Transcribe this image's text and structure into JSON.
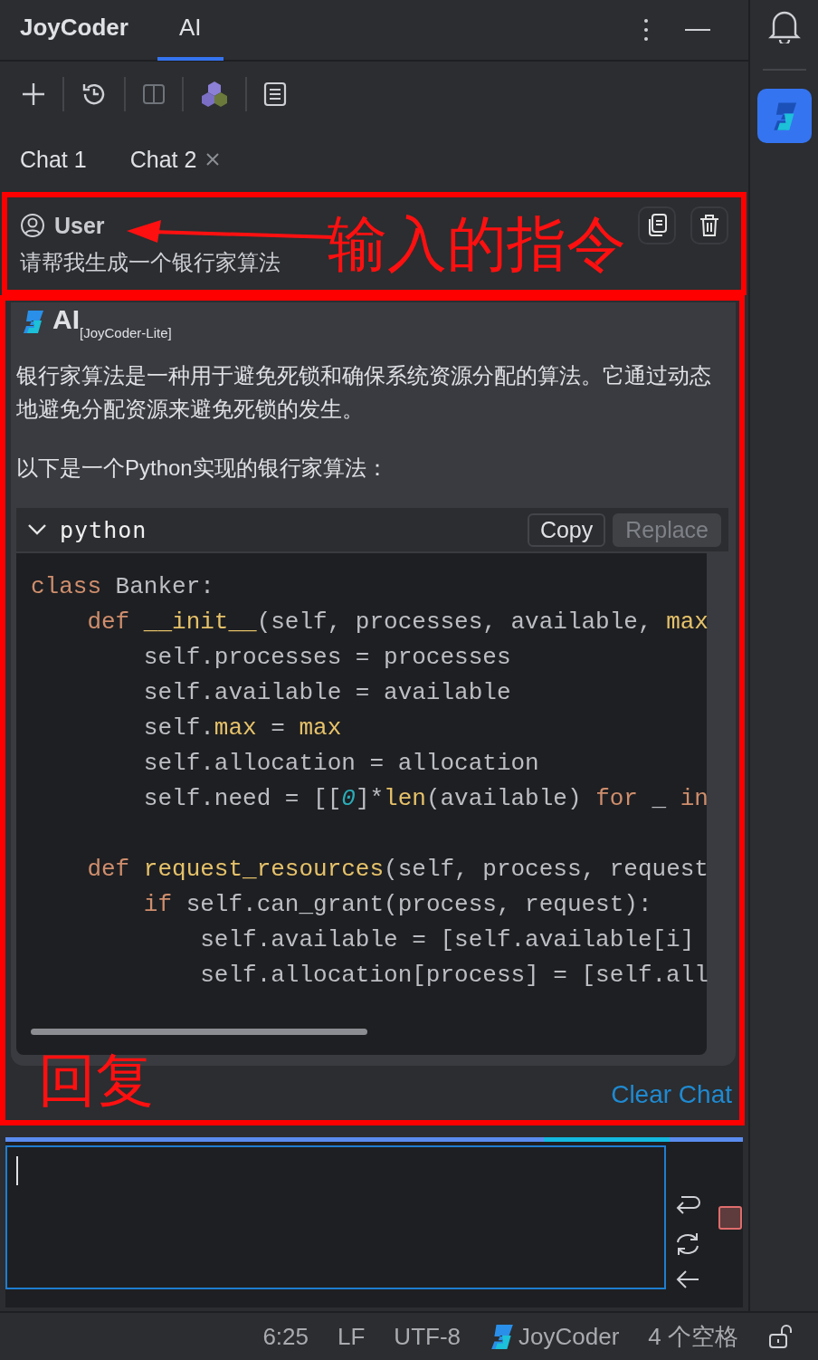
{
  "header_tabs": [
    {
      "label": "JoyCoder",
      "selected": false
    },
    {
      "label": "AI",
      "selected": true
    }
  ],
  "chat_tabs": [
    {
      "label": "Chat 1",
      "selected": false,
      "closable": false
    },
    {
      "label": "Chat 2",
      "selected": true,
      "closable": true
    }
  ],
  "user_message": {
    "author": "User",
    "text": "请帮我生成一个银行家算法",
    "annotation": "输入的指令"
  },
  "reply": {
    "author": "AI",
    "model": "[JoyCoder-Lite]",
    "annotation": "回复",
    "paragraphs": [
      "银行家算法是一种用于避免死锁和确保系统资源分配的算法。它通过动态地避免分配资源来避免死锁的发生。",
      "以下是一个Python实现的银行家算法："
    ],
    "code": {
      "language": "python",
      "expanded": true,
      "buttons": [
        {
          "label": "Copy",
          "disabled": false
        },
        {
          "label": "Replace",
          "disabled": true
        }
      ],
      "groups": [
        [
          [
            {
              "kind": "kw",
              "text": "class"
            },
            {
              "kind": "plain",
              "text": " Banker:"
            }
          ],
          [
            {
              "kind": "kw",
              "text": "    def "
            },
            {
              "kind": "fn",
              "text": "__init__"
            },
            {
              "kind": "plain",
              "text": "(self, processes, available, "
            },
            {
              "kind": "fn",
              "text": "max"
            }
          ],
          [
            {
              "kind": "plain",
              "text": "        self.processes = processes"
            }
          ],
          [
            {
              "kind": "plain",
              "text": "        self.available = available"
            }
          ],
          [
            {
              "kind": "plain",
              "text": "        self."
            },
            {
              "kind": "fn",
              "text": "max"
            },
            {
              "kind": "plain",
              "text": " = "
            },
            {
              "kind": "fn",
              "text": "max"
            }
          ],
          [
            {
              "kind": "plain",
              "text": "        self.allocation = allocation"
            }
          ],
          [
            {
              "kind": "plain",
              "text": "        self.need = [["
            },
            {
              "kind": "num",
              "text": "0"
            },
            {
              "kind": "plain",
              "text": "]*"
            },
            {
              "kind": "fn",
              "text": "len"
            },
            {
              "kind": "plain",
              "text": "(available) "
            },
            {
              "kind": "kw",
              "text": "for"
            },
            {
              "kind": "plain",
              "text": " _ "
            },
            {
              "kind": "kw",
              "text": "in"
            }
          ]
        ],
        [
          [
            {
              "kind": "kw",
              "text": "    def "
            },
            {
              "kind": "fn",
              "text": "request_resources"
            },
            {
              "kind": "plain",
              "text": "(self, process, request"
            }
          ],
          [
            {
              "kind": "kw",
              "text": "        if"
            },
            {
              "kind": "plain",
              "text": " self.can_grant(process, request):"
            }
          ],
          [
            {
              "kind": "plain",
              "text": "            self.available = [self.available[i]"
            }
          ],
          [
            {
              "kind": "plain",
              "text": "            self.allocation[process] = [self.all"
            }
          ]
        ]
      ]
    },
    "clear_link": "Clear Chat"
  },
  "input": {
    "progress": {
      "level": 0.9
    }
  },
  "status_bar": [
    "6:25",
    "LF",
    "UTF-8",
    "JoyCoder",
    "4 个空格"
  ]
}
